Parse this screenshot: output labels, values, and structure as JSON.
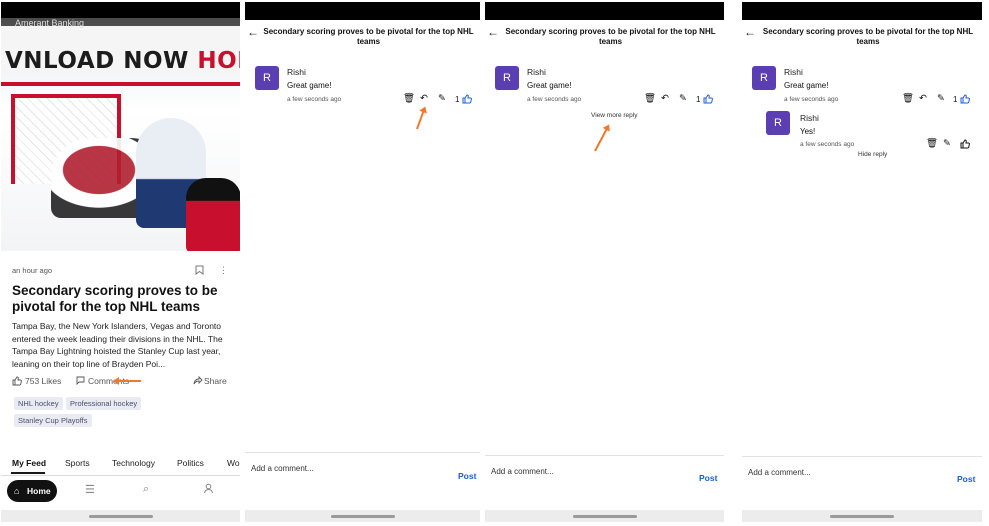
{
  "feed": {
    "hero_board_text": "VNLOAD NOW",
    "hero_board_text_red": "HON",
    "hero_top_text": "Amerant Banking",
    "time": "an hour ago",
    "headline": "Secondary scoring proves to be pivotal for the top NHL teams",
    "summary": "Tampa Bay, the New York Islanders, Vegas and Toronto entered the week leading their divisions in the NHL. The Tampa Bay Lightning hoisted the Stanley Cup last year, leaning on their top line of Brayden Poi...",
    "likes": "753 Likes",
    "comments": "Comments",
    "share": "Share",
    "tags": [
      "NHL hockey",
      "Professional hockey",
      "Stanley Cup Playoffs"
    ],
    "tabs": [
      "My Feed",
      "Sports",
      "Technology",
      "Politics",
      "Wor"
    ],
    "nav_home": "Home"
  },
  "thread": {
    "title": "Secondary scoring proves to be pivotal for the top NHL teams",
    "input_placeholder": "Add a comment...",
    "post_label": "Post",
    "comment": {
      "avatar_letter": "R",
      "author": "Rishi",
      "text": "Great game!",
      "time": "a few seconds ago",
      "likes": "1"
    },
    "view_more_reply": "View more reply",
    "reply": {
      "avatar_letter": "R",
      "author": "Rishi",
      "text": "Yes!",
      "time": "a few seconds ago"
    },
    "hide_reply": "Hide reply"
  },
  "colors": {
    "accent": "#1a5fd0",
    "avatar": "#5a3eb2",
    "annotation_arrow": "#f0782a"
  }
}
